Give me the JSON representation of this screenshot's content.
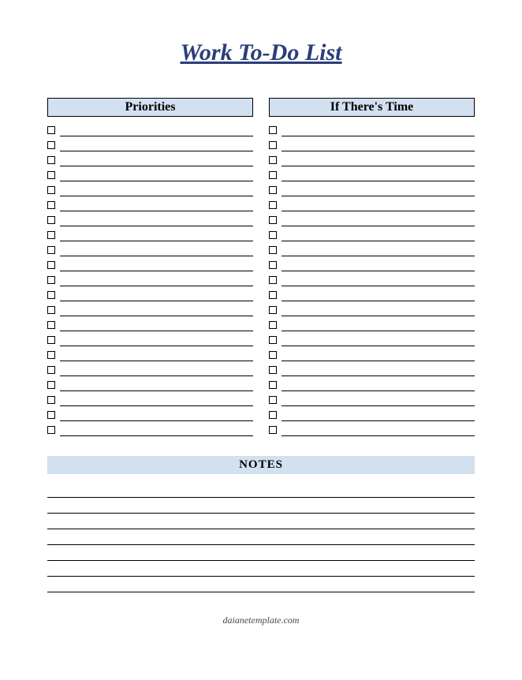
{
  "title": "Work To-Do List",
  "columns": {
    "priorities": {
      "header": "Priorities",
      "rows": 21
    },
    "ifTime": {
      "header": "If There's Time",
      "rows": 21
    }
  },
  "notes": {
    "header": "NOTES",
    "lines": 7
  },
  "footer": "daianetemplate.com"
}
